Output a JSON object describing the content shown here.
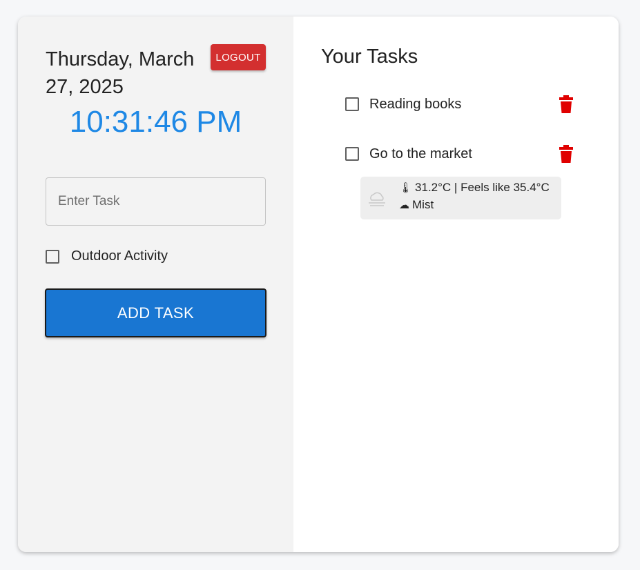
{
  "header": {
    "date": "Thursday, March 27, 2025",
    "logout_label": "LOGOUT",
    "time": "10:31:46 PM"
  },
  "form": {
    "task_placeholder": "Enter Task",
    "task_value": "",
    "outdoor_label": "Outdoor Activity",
    "outdoor_checked": false,
    "add_label": "ADD TASK"
  },
  "tasks": {
    "title": "Your Tasks",
    "items": [
      {
        "label": "Reading books",
        "checked": false
      },
      {
        "label": "Go to the market",
        "checked": false
      }
    ],
    "weather": {
      "temp_icon": "thermometer-icon",
      "temp_text": "31.2°C | Feels like 35.4°C",
      "condition_icon": "cloud-icon",
      "condition_text": "Mist"
    }
  },
  "colors": {
    "accent": "#1976d2",
    "clock": "#1e88e5",
    "logout": "#d32f2f",
    "delete": "#e00000",
    "left_panel": "#f3f3f3",
    "weather_bg": "#eeeeee"
  }
}
